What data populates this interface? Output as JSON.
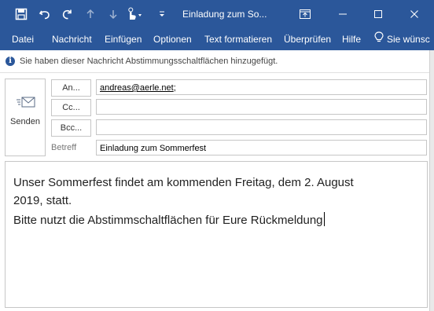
{
  "window": {
    "title": "Einladung zum So...",
    "accent": "#2b579a",
    "icons": [
      "save-icon",
      "undo-icon",
      "redo-icon",
      "up-arrow-icon",
      "down-arrow-icon",
      "touch-mode-icon",
      "customize-dropdown-icon",
      "ribbon-display-icon",
      "minimize-icon",
      "maximize-icon",
      "close-icon"
    ]
  },
  "ribbon": {
    "tabs": [
      "Datei",
      "Nachricht",
      "Einfügen",
      "Optionen",
      "Text formatieren",
      "Überprüfen",
      "Hilfe"
    ],
    "tell_me": "Sie wünsc"
  },
  "infobar": {
    "text": "Sie haben dieser Nachricht Abstimmungsschaltflächen hinzugefügt."
  },
  "compose": {
    "send_label": "Senden",
    "to_button": "An...",
    "cc_button": "Cc...",
    "bcc_button": "Bcc...",
    "to_value": "andreas@aerle.net",
    "to_separator": ";",
    "cc_value": "",
    "bcc_value": "",
    "subject_label": "Betreff",
    "subject_value": "Einladung zum Sommerfest"
  },
  "body": {
    "lines": [
      "Unser Sommerfest findet am kommenden Freitag, dem 2. August",
      "2019, statt.",
      "Bitte nutzt die Abstimmschaltflächen für Eure Rückmeldung"
    ]
  }
}
